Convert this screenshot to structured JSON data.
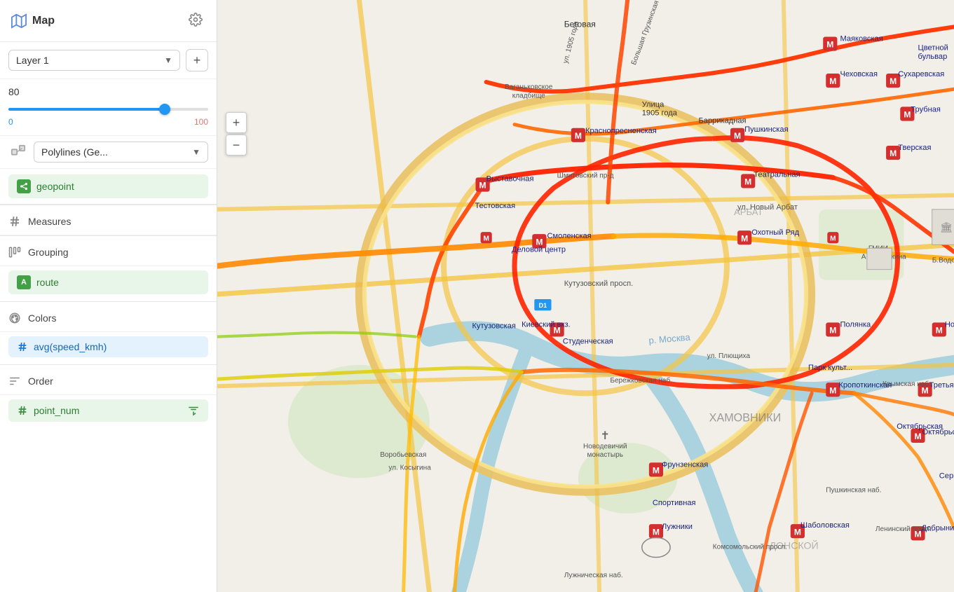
{
  "header": {
    "title": "Map",
    "map_icon": "map-icon",
    "gear_icon": "gear-icon"
  },
  "layer": {
    "name": "Layer 1",
    "add_label": "+",
    "dropdown_icon": "chevron-down-icon"
  },
  "opacity": {
    "value": "80",
    "min": "0",
    "max": "100",
    "slider_percent": 80
  },
  "geometry": {
    "type": "Polylines (Ge...",
    "icon": "polylines-icon"
  },
  "geopoint": {
    "label": "geopoint"
  },
  "measures": {
    "title": "Measures",
    "icon": "hash-icon"
  },
  "grouping": {
    "title": "Grouping",
    "icon": "grouping-icon",
    "field": "route"
  },
  "colors": {
    "title": "Colors",
    "icon": "colors-icon",
    "field": "avg(speed_kmh)",
    "field_icon": "hash-blue-icon"
  },
  "order": {
    "title": "Order",
    "icon": "order-icon",
    "field": "point_num",
    "field_icon": "hash-green-icon",
    "sort_icon": "sort-icon"
  },
  "map": {
    "zoom_in": "+",
    "zoom_out": "−"
  }
}
